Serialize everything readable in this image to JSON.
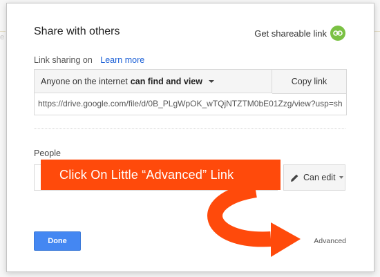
{
  "background_edge_text": "e",
  "dialog": {
    "title": "Share with others",
    "get_link_label": "Get shareable link",
    "link_icon": "link-icon",
    "link_sharing_label": "Link sharing on",
    "learn_more": "Learn more",
    "access_prefix": "Anyone on the internet",
    "access_bold": "can find and view",
    "copy_link": "Copy link",
    "url": "https://drive.google.com/file/d/0B_PLgWpOK_wTQjNTZTM0bE01Zzg/view?usp=sh",
    "people_label": "People",
    "people_input_placeholder": "",
    "permission": "Can edit",
    "permission_icon": "pencil-icon",
    "done": "Done",
    "advanced": "Advanced"
  },
  "annotation": {
    "callout_text": "Click On Little “Advanced” Link",
    "color": "#ff4a0b"
  },
  "colors": {
    "accent_blue": "#4487f2",
    "link_green": "#7ac143",
    "link_text": "#1a5fd6"
  }
}
